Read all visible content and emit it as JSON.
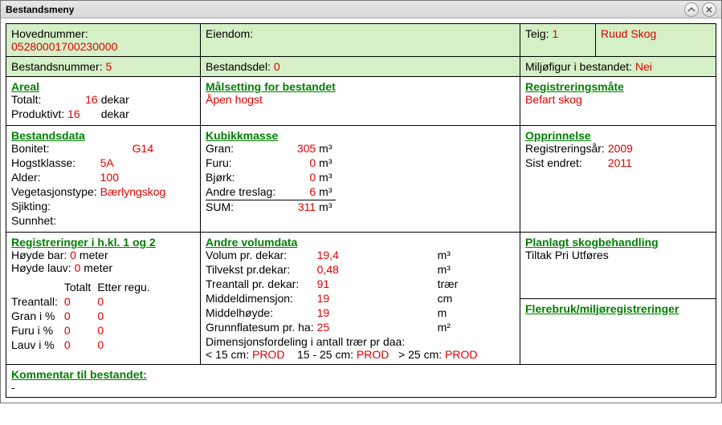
{
  "window": {
    "title": "Bestandsmeny"
  },
  "header": {
    "hovednummer_label": "Hovednummer:",
    "hovednummer_value": "05280001700230000",
    "eiendom_label": "Eiendom:",
    "eiendom_value": "",
    "teig_label": "Teig:",
    "teig_value": "1",
    "owner_value": "Ruud Skog",
    "bestandsnummer_label": "Bestandsnummer:",
    "bestandsnummer_value": "5",
    "bestandsdel_label": "Bestandsdel:",
    "bestandsdel_value": "0",
    "miljofigur_label": "Miljøfigur i bestandet:",
    "miljofigur_value": "Nei"
  },
  "areal": {
    "title": "Areal",
    "totalt_label": "Totalt:",
    "totalt_value": "16",
    "totalt_unit": "dekar",
    "produktivt_label": "Produktivt:",
    "produktivt_value": "16",
    "produktivt_unit": "dekar"
  },
  "maalsetting": {
    "title": "Målsetting for bestandet",
    "value": "Åpen hogst"
  },
  "registreringsmaate": {
    "title": "Registreringsmåte",
    "value": "Befart skog"
  },
  "bestandsdata": {
    "title": "Bestandsdata",
    "bonitet_label": "Bonitet:",
    "bonitet_value": "G14",
    "hogstklasse_label": "Hogstklasse:",
    "hogstklasse_value": "5A",
    "alder_label": "Alder:",
    "alder_value": "100",
    "vegetasjonstype_label": "Vegetasjonstype:",
    "vegetasjonstype_value": "Bærlyngskog",
    "sjikting_label": "Sjikting:",
    "sunnhet_label": "Sunnhet:"
  },
  "kubikkmasse": {
    "title": "Kubikkmasse",
    "rows": [
      {
        "label": "Gran:",
        "value": "305",
        "unit": "m³"
      },
      {
        "label": "Furu:",
        "value": "0",
        "unit": "m³"
      },
      {
        "label": "Bjørk:",
        "value": "0",
        "unit": "m³"
      },
      {
        "label": "Andre treslag:",
        "value": "6",
        "unit": "m³"
      }
    ],
    "sum_label": "SUM:",
    "sum_value": "311",
    "sum_unit": "m³"
  },
  "opprinnelse": {
    "title": "Opprinnelse",
    "registreringsaar_label": "Registreringsår:",
    "registreringsaar_value": "2009",
    "sistendret_label": "Sist endret:",
    "sistendret_value": "2011"
  },
  "hkl12": {
    "title": "Registreringer i h.kl. 1 og 2",
    "hoyde_bar_label": "Høyde bar:",
    "hoyde_bar_value": "0",
    "hoyde_bar_unit": "meter",
    "hoyde_lauv_label": "Høyde lauv:",
    "hoyde_lauv_value": "0",
    "hoyde_lauv_unit": "meter",
    "col_totalt": "Totalt",
    "col_etter": "Etter regu.",
    "rows": [
      {
        "label": "Treantall:",
        "totalt": "0",
        "etter": "0"
      },
      {
        "label": "Gran i %",
        "totalt": "0",
        "etter": "0"
      },
      {
        "label": "Furu i %",
        "totalt": "0",
        "etter": "0"
      },
      {
        "label": "Lauv i %",
        "totalt": "0",
        "etter": "0"
      }
    ]
  },
  "andre_volumdata": {
    "title": "Andre volumdata",
    "rows": [
      {
        "label": "Volum pr. dekar:",
        "value": "19,4",
        "unit": "m³"
      },
      {
        "label": "Tilvekst pr.dekar:",
        "value": "0,48",
        "unit": "m³"
      },
      {
        "label": "Treantall pr. dekar:",
        "value": "91",
        "unit": "trær"
      },
      {
        "label": "Middeldimensjon:",
        "value": "19",
        "unit": "cm"
      },
      {
        "label": "Middelhøyde:",
        "value": "19",
        "unit": "m"
      },
      {
        "label": "Grunnflatesum pr. ha:",
        "value": "25",
        "unit": "m²"
      }
    ],
    "dim_label": "Dimensjonsfordeling i antall trær pr daa:",
    "lt15_label": "< 15 cm:",
    "lt15_value": "PROD",
    "b1525_label": "15 - 25 cm:",
    "b1525_value": "PROD",
    "gt25_label": "> 25 cm:",
    "gt25_value": "PROD"
  },
  "planlagt": {
    "title": "Planlagt skogbehandling",
    "col1": "Tiltak",
    "col2": "Pri",
    "col3": "Utføres"
  },
  "flerebruk": {
    "title": "Flerebruk/miljøregistreringer"
  },
  "kommentar": {
    "title": "Kommentar til bestandet:",
    "value": "-"
  }
}
